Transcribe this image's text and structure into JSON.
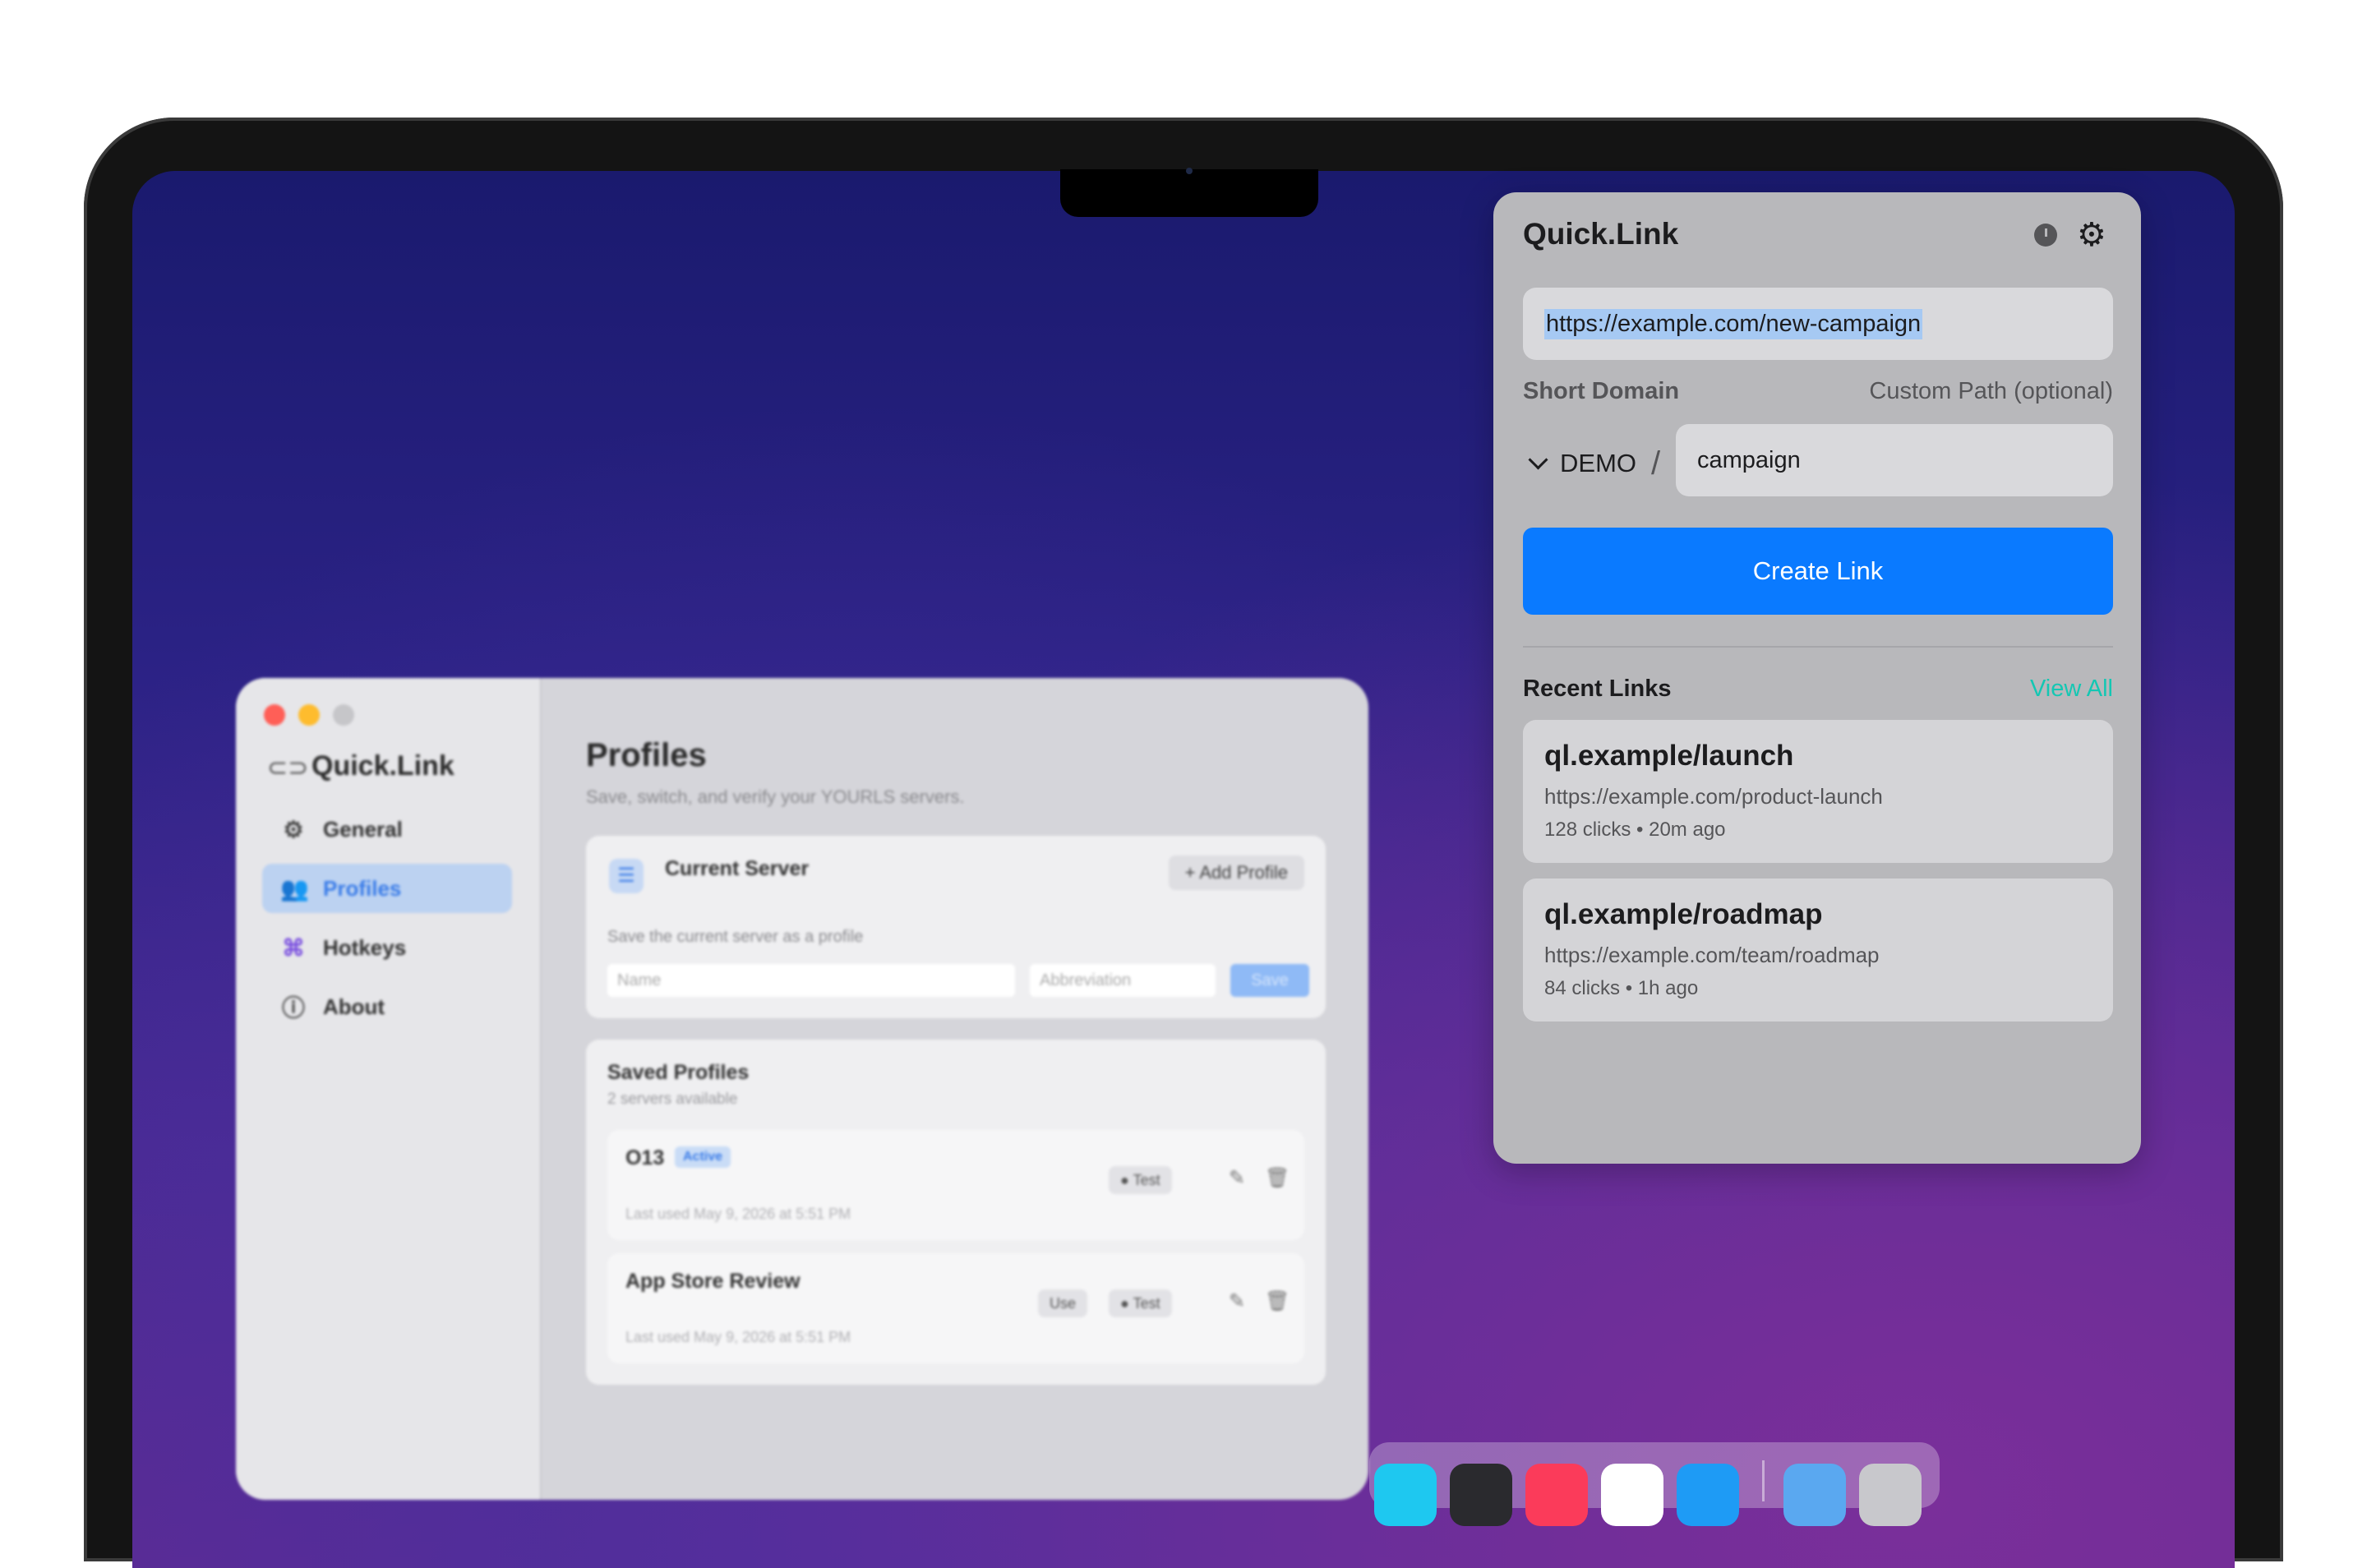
{
  "settings_window": {
    "app_name": "Quick.Link",
    "nav": [
      {
        "label": "General",
        "icon": "gear-icon"
      },
      {
        "label": "Profiles",
        "icon": "people-icon"
      },
      {
        "label": "Hotkeys",
        "icon": "command-icon"
      },
      {
        "label": "About",
        "icon": "info-icon"
      }
    ],
    "title": "Profiles",
    "subtitle": "Save, switch, and verify your YOURLS servers.",
    "current_server": {
      "title": "Current Server",
      "add_button": "+ Add Profile",
      "description": "Save the current server as a profile",
      "name_placeholder": "Name",
      "abbreviation_placeholder": "Abbreviation",
      "save_button": "Save"
    },
    "saved_profiles": {
      "title": "Saved Profiles",
      "subtitle": "2 servers available",
      "profiles": [
        {
          "name": "O13",
          "badge": "Active",
          "last_used": "Last used May 9, 2026 at 5:51 PM",
          "test_label": "Test"
        },
        {
          "name": "App Store Review",
          "use_label": "Use",
          "last_used": "Last used May 9, 2026 at 5:51 PM",
          "test_label": "Test"
        }
      ]
    }
  },
  "popover": {
    "title": "Quick.Link",
    "icons": [
      "history-clock-icon",
      "gear-icon"
    ],
    "url_value": "https://example.com/new-campaign",
    "short_domain_label": "Short Domain",
    "custom_path_label": "Custom Path (optional)",
    "domain_selected": "DEMO",
    "separator": "/",
    "path_value": "campaign",
    "create_button": "Create Link",
    "recent_title": "Recent Links",
    "view_all": "View All",
    "recent_links": [
      {
        "short": "ql.example/launch",
        "long": "https://example.com/product-launch",
        "meta": "128 clicks • 20m ago"
      },
      {
        "short": "ql.example/roadmap",
        "long": "https://example.com/team/roadmap",
        "meta": "84 clicks • 1h ago"
      }
    ],
    "colors": {
      "accent": "#0a7aff",
      "link": "#14c7b3",
      "selection": "#a6c9f3"
    }
  },
  "dock": {
    "apps": [
      "messages-icon",
      "terminal-icon",
      "music-icon",
      "news-icon",
      "app-store-icon",
      "folder-icon",
      "trash-icon"
    ]
  }
}
